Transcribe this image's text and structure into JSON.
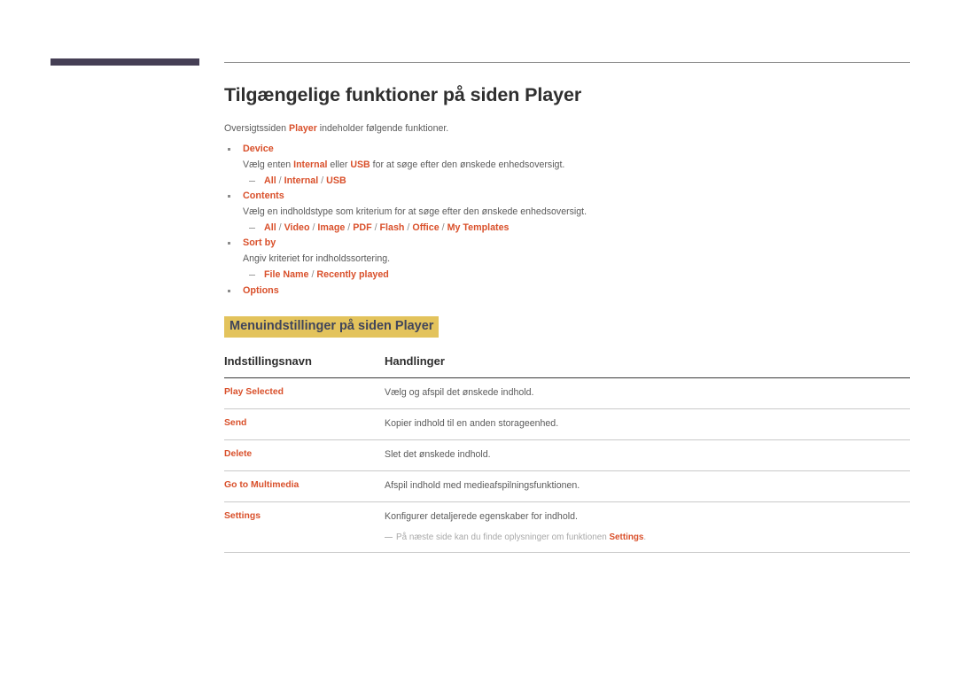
{
  "page": {
    "title": "Tilgængelige funktioner på siden Player",
    "intro_before": "Oversigtssiden ",
    "intro_highlight": "Player",
    "intro_after": " indeholder følgende funktioner."
  },
  "features": [
    {
      "name": "Device",
      "description_before": "Vælg enten ",
      "description_hl1": "Internal",
      "description_mid": " eller ",
      "description_hl2": "USB",
      "description_after": " for at søge efter den ønskede enhedsoversigt.",
      "options": [
        "All",
        "Internal",
        "USB"
      ]
    },
    {
      "name": "Contents",
      "description": "Vælg en indholdstype som kriterium for at søge efter den ønskede enhedsoversigt.",
      "options": [
        "All",
        "Video",
        "Image",
        "PDF",
        "Flash",
        "Office",
        "My Templates"
      ]
    },
    {
      "name": "Sort by",
      "description": "Angiv kriteriet for indholdssortering.",
      "options": [
        "File Name",
        "Recently played"
      ]
    },
    {
      "name": "Options",
      "description": "",
      "options": []
    }
  ],
  "section": {
    "heading": "Menuindstillinger på siden Player"
  },
  "table": {
    "columns": [
      "Indstillingsnavn",
      "Handlinger"
    ],
    "rows": [
      {
        "name": "Play Selected",
        "action": "Vælg og afspil det ønskede indhold."
      },
      {
        "name": "Send",
        "action": "Kopier indhold til en anden storageenhed."
      },
      {
        "name": "Delete",
        "action": "Slet det ønskede indhold."
      },
      {
        "name": "Go to Multimedia",
        "action": "Afspil indhold med medieafspilningsfunktionen."
      },
      {
        "name": "Settings",
        "action": "Konfigurer detaljerede egenskaber for indhold.",
        "note_before": "På næste side kan du finde oplysninger om funktionen ",
        "note_bold": "Settings",
        "note_after": "."
      }
    ]
  },
  "colors": {
    "accent": "#d9502b",
    "highlight_bg": "#e3c35c",
    "highlight_text": "#40455b",
    "deco_bar": "#453f55",
    "body_text": "#5b5b5b"
  }
}
